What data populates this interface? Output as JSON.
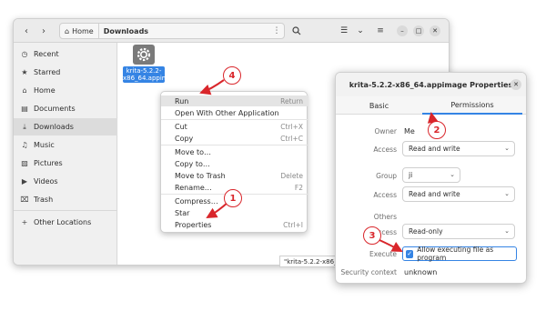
{
  "file_manager": {
    "path": {
      "home": "Home",
      "current": "Downloads"
    },
    "sidebar": [
      {
        "label": "Recent",
        "icon": "clock-icon",
        "glyph": "◷"
      },
      {
        "label": "Starred",
        "icon": "star-icon",
        "glyph": "★"
      },
      {
        "label": "Home",
        "icon": "home-icon",
        "glyph": "⌂"
      },
      {
        "label": "Documents",
        "icon": "document-icon",
        "glyph": "▤"
      },
      {
        "label": "Downloads",
        "icon": "download-icon",
        "glyph": "⤓"
      },
      {
        "label": "Music",
        "icon": "music-icon",
        "glyph": "♫"
      },
      {
        "label": "Pictures",
        "icon": "picture-icon",
        "glyph": "▨"
      },
      {
        "label": "Videos",
        "icon": "video-icon",
        "glyph": "▶"
      },
      {
        "label": "Trash",
        "icon": "trash-icon",
        "glyph": "🗑"
      },
      {
        "label": "Other Locations",
        "icon": "plus-icon",
        "glyph": "+"
      }
    ],
    "selected_file_label": "krita-5.2.2-x86_64.appimage",
    "status_text": "\"krita-5.2.2-x86_64.appimage\" selected"
  },
  "context_menu": [
    {
      "label": "Run",
      "shortcut": "Return"
    },
    {
      "label": "Open With Other Application",
      "shortcut": ""
    },
    {
      "label": "Cut",
      "shortcut": "Ctrl+X"
    },
    {
      "label": "Copy",
      "shortcut": "Ctrl+C"
    },
    {
      "label": "Move to…",
      "shortcut": ""
    },
    {
      "label": "Copy to…",
      "shortcut": ""
    },
    {
      "label": "Move to Trash",
      "shortcut": "Delete"
    },
    {
      "label": "Rename…",
      "shortcut": "F2"
    },
    {
      "label": "Compress…",
      "shortcut": ""
    },
    {
      "label": "Star",
      "shortcut": ""
    },
    {
      "label": "Properties",
      "shortcut": "Ctrl+I"
    }
  ],
  "properties_dialog": {
    "title": "krita-5.2.2-x86_64.appimage Properties",
    "tabs": [
      "Basic",
      "Permissions"
    ],
    "owner_label": "Owner",
    "owner_value": "Me",
    "owner_access_label": "Access",
    "owner_access": "Read and write",
    "group_label": "Group",
    "group_value": "ji",
    "group_access_label": "Access",
    "group_access": "Read and write",
    "others_label": "Others",
    "others_access_label": "Access",
    "others_access": "Read-only",
    "execute_label": "Execute",
    "execute_checkbox": "Allow executing file as program",
    "security_label": "Security context",
    "security_value": "unknown"
  },
  "callouts": [
    "1",
    "2",
    "3",
    "4"
  ],
  "colors": {
    "accent": "#3584e4",
    "annotation": "#d9262b"
  }
}
